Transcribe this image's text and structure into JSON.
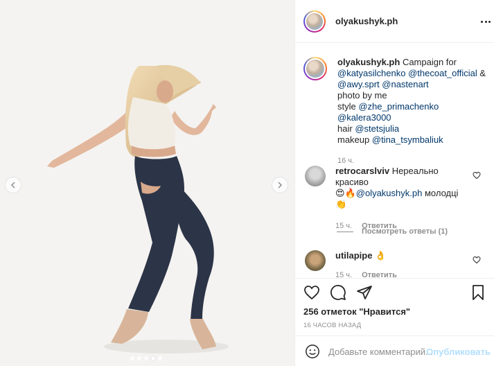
{
  "header": {
    "username": "olyakushyk.ph"
  },
  "caption": {
    "username": "olyakushyk.ph",
    "line1_text": "Campaign for",
    "line1_mentions": [
      "@katyasilchenko",
      "@thecoat_official"
    ],
    "amp": "&",
    "line2_mentions": [
      "@awy.sprt",
      "@nastenart"
    ],
    "photo_by": "photo by me",
    "style_label": "style",
    "style_mentions": [
      "@zhe_primachenko",
      "@kalera3000"
    ],
    "hair_label": "hair",
    "hair_mention": "@stetsjulia",
    "makeup_label": "makeup",
    "makeup_mention": "@tina_tsymbaliuk",
    "time": "16 ч."
  },
  "comments": [
    {
      "username": "retrocarslviv",
      "text": "Нереально красиво",
      "emoji_before": "😍🔥",
      "mention": "@olyakushyk.ph",
      "text_after": "молодці",
      "emoji_after": "👏",
      "time": "15 ч.",
      "reply_label": "Ответить",
      "view_replies": "Посмотреть ответы (1)"
    },
    {
      "username": "utilapipe",
      "emoji": "👌",
      "time": "15 ч.",
      "reply_label": "Ответить"
    }
  ],
  "actions": {
    "likes": "256 отметок \"Нравится\"",
    "posted": "16 часов назад"
  },
  "add_comment": {
    "placeholder": "Добавьте комментарий...",
    "publish_label": "Опубликовать"
  },
  "colors": {
    "mention": "#00376b",
    "muted": "#8e8e8e",
    "publish_disabled": "#b2dffc"
  },
  "carousel": {
    "count": 5,
    "active_index": 3
  }
}
